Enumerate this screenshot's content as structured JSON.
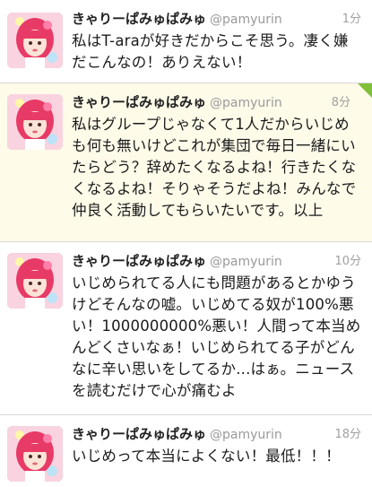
{
  "tweets": [
    {
      "display_name": "きゃりーぱみゅぱみゅ",
      "handle": "@pamyurin",
      "time": "1分",
      "text": "私はT-araが好きだからこそ思う。凄く嫌だこんなの！ありえない！"
    },
    {
      "display_name": "きゃりーぱみゅぱみゅ",
      "handle": "@pamyurin",
      "time": "8分",
      "text": "私はグループじゃなくて1人だからいじめも何も無いけどこれが集団で毎日一緒にいたらどう？辞めたくなるよね！行きたくなくなるよね！そりゃそうだよね！みんなで仲良く活動してもらいたいです。以上"
    },
    {
      "display_name": "きゃりーぱみゅぱみゅ",
      "handle": "@pamyurin",
      "time": "10分",
      "text": "いじめられてる人にも問題があるとかゆうけどそんなの嘘。いじめてる奴が100%悪い！1000000000%悪い！人間って本当めんどくさいなぁ！いじめられてる子がどんなに辛い思いをしてるか...はぁ。ニュースを読むだけで心が痛むよ"
    },
    {
      "display_name": "きゃりーぱみゅぱみゅ",
      "handle": "@pamyurin",
      "time": "18分",
      "text": "いじめって本当によくない！最低！！！"
    }
  ],
  "icons": {
    "avatar": "profile-avatar-icon",
    "badge": "corner-badge-icon"
  },
  "colors": {
    "highlight_bg": "#fefbe9",
    "badge": "#7fbf3a"
  }
}
